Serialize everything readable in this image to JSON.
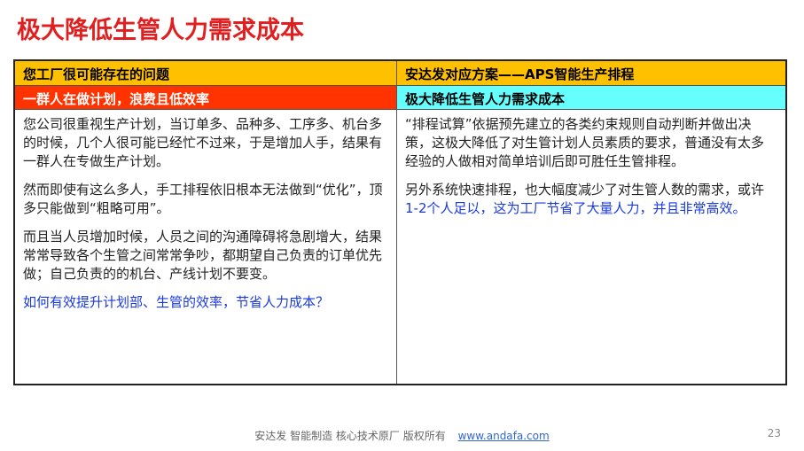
{
  "title": "极大降低生管人力需求成本",
  "table": {
    "left": {
      "header": "您工厂很可能存在的问题",
      "subheader": "一群人在做计划，浪费且低效率",
      "paragraphs": [
        "您公司很重视生产计划，当订单多、品种多、工序多、机台多的时候，几个人很可能已经忙不过来，于是增加人手，结果有一群人在专做生产计划。",
        "然而即使有这么多人，手工排程依旧根本无法做到“优化”，顶多只能做到“粗略可用”。",
        "而且当人员增加时候，人员之间的沟通障碍将急剧增大，结果常常导致各个生管之间常常争吵，都期望自己负责的订单优先做；自己负责的的机台、产线计划不要变。"
      ],
      "question": "如何有效提升计划部、生管的效率，节省人力成本？"
    },
    "right": {
      "header": "安达发对应方案——APS智能生产排程",
      "subheader": "极大降低生管人力需求成本",
      "paragraph1": "“排程试算”依据预先建立的各类约束规则自动判断并做出决策，这极大降低了对生管计划人员素质的要求，普通没有太多经验的人做相对简单培训后即可胜任生管排程。",
      "paragraph2_plain": "另外系统快速排程，也大幅度减少了对生管人数的需求，或许",
      "paragraph2_blue": "1-2个人足以，这为工厂节省了大量人力，并且非常高效。"
    }
  },
  "footer": {
    "text": "安达发   智能制造 核心技术原厂    版权所有",
    "link": "www.andafa.com",
    "page_number": "23"
  },
  "colors": {
    "title": "#e02020",
    "header_bg": "#ffc000",
    "left_sub_bg": "#ff3300",
    "right_sub_bg": "#66ffff",
    "highlight_text": "#1a3adf"
  }
}
